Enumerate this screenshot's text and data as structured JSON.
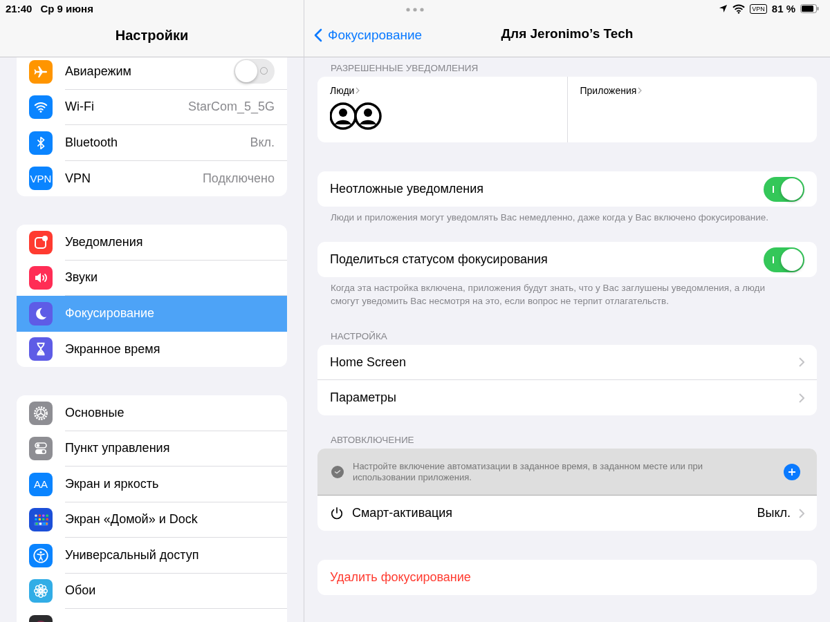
{
  "status_bar": {
    "time": "21:40",
    "date": "Ср 9 июня",
    "vpn": "VPN",
    "battery": "81 %"
  },
  "sidebar": {
    "title": "Настройки",
    "groups": [
      [
        {
          "label": "Авиарежим",
          "color": "#ff9500",
          "kind": "toggle",
          "on": false,
          "selected": false
        },
        {
          "label": "Wi-Fi",
          "color": "#0a84ff",
          "kind": "value",
          "value": "StarCom_5_5G",
          "selected": false
        },
        {
          "label": "Bluetooth",
          "color": "#0a84ff",
          "kind": "value",
          "value": "Вкл.",
          "selected": false
        },
        {
          "label": "VPN",
          "icon_text": "VPN",
          "color": "#0a84ff",
          "kind": "value",
          "value": "Подключено",
          "selected": false
        }
      ],
      [
        {
          "label": "Уведомления",
          "color": "#ff3b30",
          "kind": "plain",
          "selected": false
        },
        {
          "label": "Звуки",
          "color": "#ff2d55",
          "kind": "plain",
          "selected": false
        },
        {
          "label": "Фокусирование",
          "color": "#5e5ce6",
          "kind": "plain",
          "selected": true
        },
        {
          "label": "Экранное время",
          "color": "#5e5ce6",
          "kind": "plain",
          "selected": false
        }
      ],
      [
        {
          "label": "Основные",
          "color": "#8e8e93",
          "kind": "plain",
          "selected": false
        },
        {
          "label": "Пункт управления",
          "color": "#8e8e93",
          "kind": "plain",
          "selected": false
        },
        {
          "label": "Экран и яркость",
          "icon_text": "AA",
          "color": "#0a84ff",
          "kind": "plain",
          "selected": false
        },
        {
          "label": "Экран «Домой» и Dock",
          "color": "#1c4fd8",
          "kind": "plain",
          "selected": false
        },
        {
          "label": "Универсальный доступ",
          "color": "#0a84ff",
          "kind": "plain",
          "selected": false
        },
        {
          "label": "Обои",
          "color": "#32ade6",
          "kind": "plain",
          "selected": false
        },
        {
          "color": "#2c2c2e",
          "kind": "plain",
          "selected": false
        }
      ]
    ]
  },
  "detail": {
    "back": "Фокусирование",
    "title": "Для Jeronimo’s Tech",
    "allowed": {
      "header": "РАЗРЕШЕННЫЕ УВЕДОМЛЕНИЯ",
      "people": "Люди",
      "apps": "Приложения"
    },
    "toggles": [
      {
        "label": "Неотложные уведомления",
        "on": true,
        "note": "Люди и приложения могут уведомлять Вас немедленно, даже когда у Вас включено фокусирование."
      },
      {
        "label": "Поделиться статусом фокусирования",
        "on": true,
        "note": "Когда эта настройка включена, приложения будут знать, что у Вас заглушены уведомления, а люди смогут уведомить Вас несмотря на это, если вопрос не терпит отлагательств."
      }
    ],
    "settings": {
      "header": "НАСТРОЙКА",
      "rows": [
        "Home Screen",
        "Параметры"
      ]
    },
    "auto": {
      "header": "АВТОВКЛЮЧЕНИЕ",
      "hint": "Настройте включение автоматизации в заданное время, в заданном месте или при использовании приложения.",
      "smart": "Смарт-активация",
      "smart_value": "Выкл."
    },
    "delete": "Удалить фокусирование"
  }
}
